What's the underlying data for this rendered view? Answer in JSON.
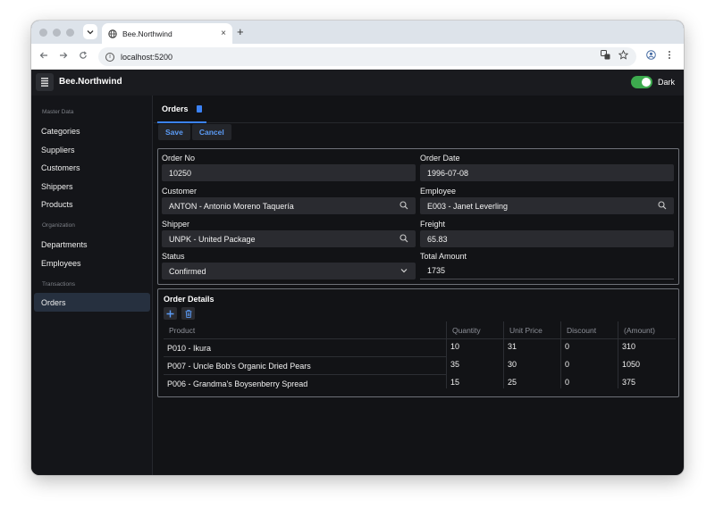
{
  "browser": {
    "tab_title": "Bee.Northwind",
    "tab_close": "×",
    "new_tab": "+",
    "url": "localhost:5200"
  },
  "app": {
    "brand": "Bee.Northwind",
    "theme_label": "Dark",
    "theme_on": true
  },
  "sidebar": {
    "sections": [
      {
        "title": "Master Data",
        "items": [
          "Categories",
          "Suppliers",
          "Customers",
          "Shippers",
          "Products"
        ]
      },
      {
        "title": "Organization",
        "items": [
          "Departments",
          "Employees"
        ]
      },
      {
        "title": "Transactions",
        "items": [
          "Orders"
        ]
      }
    ],
    "active": "Orders"
  },
  "main": {
    "tab": "Orders",
    "save_label": "Save",
    "cancel_label": "Cancel"
  },
  "form": {
    "order_no": {
      "label": "Order No",
      "value": "10250"
    },
    "order_date": {
      "label": "Order Date",
      "value": "1996-07-08"
    },
    "customer": {
      "label": "Customer",
      "value": "ANTON - Antonio Moreno Taquería"
    },
    "employee": {
      "label": "Employee",
      "value": "E003 - Janet Leverling"
    },
    "shipper": {
      "label": "Shipper",
      "value": "UNPK - United Package"
    },
    "freight": {
      "label": "Freight",
      "value": "65.83"
    },
    "status": {
      "label": "Status",
      "value": "Confirmed"
    },
    "total": {
      "label": "Total Amount",
      "value": "1735"
    }
  },
  "details": {
    "title": "Order Details",
    "columns": [
      "Product",
      "Quantity",
      "Unit Price",
      "Discount",
      "(Amount)"
    ],
    "rows": [
      [
        "P010 - Ikura",
        "10",
        "31",
        "0",
        "310"
      ],
      [
        "P007 - Uncle Bob's Organic Dried Pears",
        "35",
        "30",
        "0",
        "1050"
      ],
      [
        "P006 - Grandma's Boysenberry Spread",
        "15",
        "25",
        "0",
        "375"
      ]
    ]
  }
}
